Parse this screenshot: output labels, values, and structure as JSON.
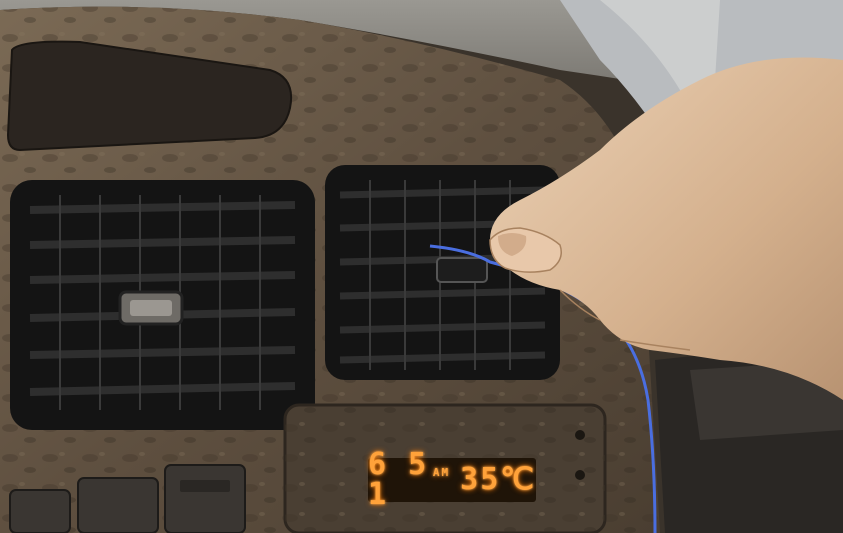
{
  "photo": {
    "dashboard_clock": {
      "time": "6 5 1",
      "meridiem": "AM",
      "temperature": "35℃"
    },
    "colors": {
      "wood_grain": "#6b5a45",
      "vent_black": "#151515",
      "display_orange": "#ffa23a",
      "wire_blue": "#4a6ee0",
      "skin": "#d9b99a"
    },
    "icons": {
      "left_vent": "air-vent-icon",
      "right_vent": "air-vent-icon"
    }
  }
}
